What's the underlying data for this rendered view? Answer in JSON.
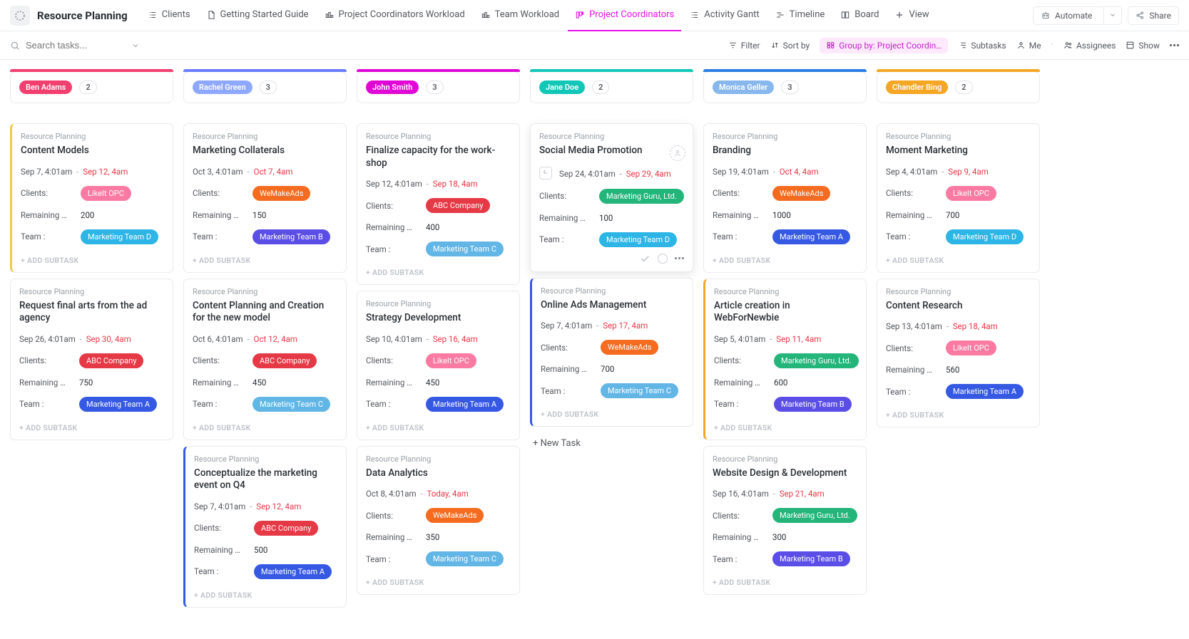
{
  "app": {
    "title": "Resource Planning"
  },
  "views": [
    {
      "label": "Clients",
      "icon": "list"
    },
    {
      "label": "Getting Started Guide",
      "icon": "doc"
    },
    {
      "label": "Project Coordinators Workload",
      "icon": "workload"
    },
    {
      "label": "Team Workload",
      "icon": "workload"
    },
    {
      "label": "Project Coordinators",
      "icon": "board",
      "active": true
    },
    {
      "label": "Activity Gantt",
      "icon": "list"
    },
    {
      "label": "Timeline",
      "icon": "timeline"
    },
    {
      "label": "Board",
      "icon": "board2"
    },
    {
      "label": "View",
      "icon": "plus"
    }
  ],
  "topButtons": {
    "automate": "Automate",
    "share": "Share"
  },
  "search": {
    "placeholder": "Search tasks..."
  },
  "filters": {
    "filter": "Filter",
    "sort": "Sort by",
    "group": "Group by: Project Coordin…",
    "subtasks": "Subtasks",
    "me": "Me",
    "assignees": "Assignees",
    "show": "Show"
  },
  "labels": {
    "clients": "Clients:",
    "remaining": "Remaining …",
    "team": "Team :",
    "addSubtask": "+ ADD SUBTASK",
    "newTask": "+ New Task",
    "project": "Resource Planning"
  },
  "clientColors": {
    "LikeIt OPC": "#fb7aa3",
    "WeMakeAds": "#f56b1f",
    "ABC Company": "#e63946",
    "Marketing Guru, Ltd.": "#24b57a"
  },
  "teamColors": {
    "Marketing Team A": "#3659e3",
    "Marketing Team B": "#5b4ee6",
    "Marketing Team C": "#62b6e5",
    "Marketing Team D": "#2db5e6"
  },
  "columns": [
    {
      "name": "Ben Adams",
      "count": "2",
      "accent": "#f23f6f",
      "chipbg": "#f23f6f",
      "cards": [
        {
          "title": "Content Models",
          "start": "Sep 7, 4:01am",
          "end": "Sep 12, 4am",
          "client": "LikeIt OPC",
          "remaining": "200",
          "team": "Marketing Team D",
          "accent": "#f2c94c"
        },
        {
          "title": "Request final arts from the ad agency",
          "start": "Sep 26, 4:01am",
          "end": "Sep 30, 4am",
          "client": "ABC Company",
          "remaining": "750",
          "team": "Marketing Team A"
        }
      ]
    },
    {
      "name": "Rachel Green",
      "count": "3",
      "accent": "#6b7cff",
      "chipbg": "#8fa8ff",
      "cards": [
        {
          "title": "Marketing Collaterals",
          "start": "Oct 3, 4:01am",
          "end": "Oct 7, 4am",
          "client": "WeMakeAds",
          "remaining": "150",
          "team": "Marketing Team B"
        },
        {
          "title": "Content Planning and Creation for the new model",
          "start": "Oct 6, 4:01am",
          "end": "Oct 12, 4am",
          "client": "ABC Company",
          "remaining": "450",
          "team": "Marketing Team C"
        },
        {
          "title": "Conceptualize the marketing event on Q4",
          "start": "Sep 7, 4:01am",
          "end": "Sep 12, 4am",
          "client": "ABC Company",
          "remaining": "500",
          "team": "Marketing Team A",
          "accent": "#3659e3"
        }
      ]
    },
    {
      "name": "John Smith",
      "count": "3",
      "accent": "#e007d6",
      "chipbg": "#e007d6",
      "cards": [
        {
          "title": "Finalize capacity for the work-shop",
          "start": "Sep 12, 4:01am",
          "end": "Sep 18, 4am",
          "client": "ABC Company",
          "remaining": "400",
          "team": "Marketing Team C"
        },
        {
          "title": "Strategy Development",
          "start": "Sep 10, 4:01am",
          "end": "Sep 16, 4am",
          "client": "LikeIt OPC",
          "remaining": "450",
          "team": "Marketing Team A"
        },
        {
          "title": "Data Analytics",
          "start": "Oct 8, 4:01am",
          "end": "Today, 4am",
          "client": "WeMakeAds",
          "remaining": "350",
          "team": "Marketing Team C"
        }
      ]
    },
    {
      "name": "Jane Doe",
      "count": "2",
      "accent": "#12c7b8",
      "chipbg": "#12c7b8",
      "cards": [
        {
          "title": "Social Media Promotion",
          "start": "Sep 24, 4:01am",
          "end": "Sep 29, 4am",
          "client": "Marketing Guru, Ltd.",
          "remaining": "100",
          "team": "Marketing Team D",
          "hover": true,
          "subtaskIcon": true
        },
        {
          "title": "Online Ads Management",
          "start": "Sep 7, 4:01am",
          "end": "Sep 17, 4am",
          "client": "WeMakeAds",
          "remaining": "700",
          "team": "Marketing Team C",
          "accent": "#3659e3"
        }
      ],
      "newTask": true
    },
    {
      "name": "Monica Geller",
      "count": "3",
      "accent": "#2a7de1",
      "chipbg": "#87b7ed",
      "cards": [
        {
          "title": "Branding",
          "start": "Sep 19, 4:01am",
          "end": "Oct 4, 4am",
          "client": "WeMakeAds",
          "remaining": "1000",
          "team": "Marketing Team A"
        },
        {
          "title": "Article creation in WebForNewbie",
          "start": "Sep 5, 4:01am",
          "end": "Sep 11, 4am",
          "client": "Marketing Guru, Ltd.",
          "remaining": "600",
          "team": "Marketing Team B",
          "accent": "#f5a623"
        },
        {
          "title": "Website Design & Development",
          "start": "Sep 16, 4:01am",
          "end": "Sep 21, 4am",
          "client": "Marketing Guru, Ltd.",
          "remaining": "300",
          "team": "Marketing Team B"
        }
      ]
    },
    {
      "name": "Chandler Bing",
      "count": "2",
      "accent": "#f5a623",
      "chipbg": "#f5a623",
      "cards": [
        {
          "title": "Moment Marketing",
          "start": "Sep 4, 4:01am",
          "end": "Sep 9, 4am",
          "client": "LikeIt OPC",
          "remaining": "700",
          "team": "Marketing Team D"
        },
        {
          "title": "Content Research",
          "start": "Sep 13, 4:01am",
          "end": "Sep 18, 4am",
          "client": "LikeIt OPC",
          "remaining": "560",
          "team": "Marketing Team A"
        }
      ]
    }
  ]
}
